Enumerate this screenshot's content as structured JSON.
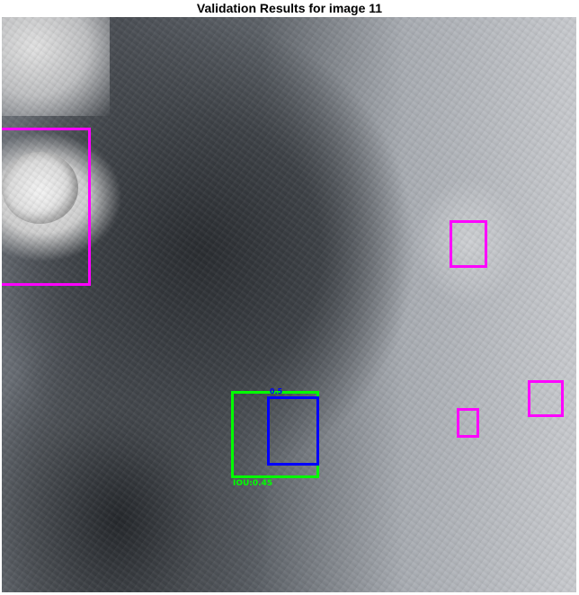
{
  "figure": {
    "title": "Validation Results for image 11"
  },
  "image": {
    "description_icon": "mars-terrain-grayscale-image"
  },
  "boxes": [
    {
      "kind": "prediction",
      "color": "#ff00ff"
    },
    {
      "kind": "prediction",
      "color": "#ff00ff"
    },
    {
      "kind": "prediction",
      "color": "#ff00ff"
    },
    {
      "kind": "prediction",
      "color": "#ff00ff"
    },
    {
      "kind": "ground-truth",
      "color": "#00ff00",
      "label": "IOU:0.45"
    },
    {
      "kind": "prediction-matched",
      "color": "#0000ff",
      "label": "0.5"
    }
  ]
}
